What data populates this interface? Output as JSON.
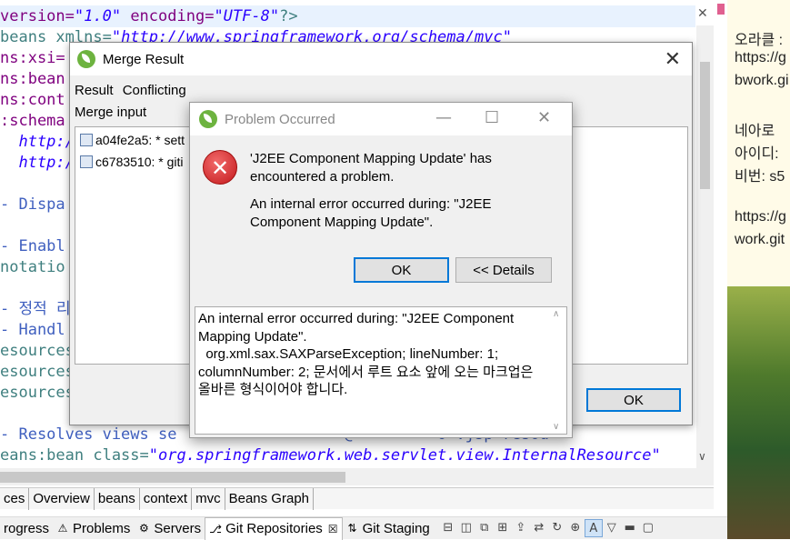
{
  "editor": {
    "lines": [
      {
        "parts": [
          {
            "t": "version=",
            "c": "attr"
          },
          {
            "t": "\"1.0\"",
            "c": "str"
          },
          {
            "t": " encoding=",
            "c": "attr"
          },
          {
            "t": "\"UTF-8\"",
            "c": "str"
          },
          {
            "t": "?>",
            "c": "kw"
          }
        ]
      },
      {
        "parts": [
          {
            "t": "beans xmlns=",
            "c": "kw"
          },
          {
            "t": "\"http://www.springframework.org/schema/mvc\"",
            "c": "str"
          }
        ]
      },
      {
        "parts": [
          {
            "t": "ns:xsi=",
            "c": "attr"
          }
        ]
      },
      {
        "parts": [
          {
            "t": "ns:bean",
            "c": "attr"
          }
        ]
      },
      {
        "parts": [
          {
            "t": "ns:cont",
            "c": "attr"
          }
        ]
      },
      {
        "parts": [
          {
            "t": ":schema",
            "c": "attr"
          }
        ]
      },
      {
        "parts": [
          {
            "t": "  http:/",
            "c": "str"
          }
        ]
      },
      {
        "parts": [
          {
            "t": "  http:/",
            "c": "str"
          }
        ]
      },
      {
        "parts": [
          {
            "t": "",
            "c": "kw"
          }
        ]
      },
      {
        "parts": [
          {
            "t": "- Dispa",
            "c": "cm"
          }
        ]
      },
      {
        "parts": [
          {
            "t": "",
            "c": "kw"
          }
        ]
      },
      {
        "parts": [
          {
            "t": "- Enabl",
            "c": "cm"
          }
        ]
      },
      {
        "parts": [
          {
            "t": "notatio",
            "c": "kw"
          }
        ]
      },
      {
        "parts": [
          {
            "t": "",
            "c": "kw"
          }
        ]
      },
      {
        "parts": [
          {
            "t": "- 정적 리",
            "c": "cm"
          }
        ]
      },
      {
        "parts": [
          {
            "t": "- Handl",
            "c": "cm"
          }
        ]
      },
      {
        "parts": [
          {
            "t": "esources",
            "c": "kw"
          }
        ]
      },
      {
        "parts": [
          {
            "t": "esources",
            "c": "kw"
          }
        ]
      },
      {
        "parts": [
          {
            "t": "esources",
            "c": "kw"
          }
        ]
      },
      {
        "parts": [
          {
            "t": "",
            "c": "kw"
          }
        ]
      },
      {
        "parts": [
          {
            "t": "- Resolves views se",
            "c": "cm"
          },
          {
            "t": "                  @",
            "c": "cm"
          },
          {
            "t": "         o .jsp resou",
            "c": "cm"
          }
        ]
      },
      {
        "parts": [
          {
            "t": "eans:bean class=",
            "c": "kw"
          },
          {
            "t": "\"org.springframework.web.servlet.view.InternalResource\"",
            "c": "str"
          }
        ]
      }
    ],
    "tabs": [
      "ces",
      "Overview",
      "beans",
      "context",
      "mvc",
      "Beans Graph"
    ]
  },
  "bottom_bar": {
    "views": [
      {
        "label": "rogress",
        "icon": "progress-icon"
      },
      {
        "label": "Problems",
        "icon": "problems-icon"
      },
      {
        "label": "Servers",
        "icon": "servers-icon"
      },
      {
        "label": "Git Repositories",
        "icon": "git-icon",
        "active": true,
        "close": "☒"
      },
      {
        "label": "Git Staging",
        "icon": "git-staging-icon"
      }
    ]
  },
  "right_pane": {
    "lines": [
      "오라클 :",
      "https://g",
      "bwork.gi",
      "",
      "네아로",
      "아이디:",
      "비번: s5",
      "",
      "https://g",
      "work.git"
    ]
  },
  "merge_dialog": {
    "title": "Merge Result",
    "result_label": "Result",
    "conflicting_label": "Conflicting",
    "input_label": "Merge input",
    "items": [
      "a04fe2a5: * sett",
      "c6783510: * giti"
    ],
    "ok_label": "OK"
  },
  "problem_dialog": {
    "title": "Problem Occurred",
    "message": "'J2EE Component Mapping Update' has encountered a problem.",
    "detail_summary": "An internal error occurred during: \"J2EE Component Mapping Update\".",
    "ok_label": "OK",
    "details_label": "<< Details",
    "details_text": "An internal error occurred during: \"J2EE Component Mapping Update\".\n  org.xml.sax.SAXParseException; lineNumber: 1; columnNumber: 2; 문서에서 루트 요소 앞에 오는 마크업은 올바른 형식이어야 합니다."
  }
}
